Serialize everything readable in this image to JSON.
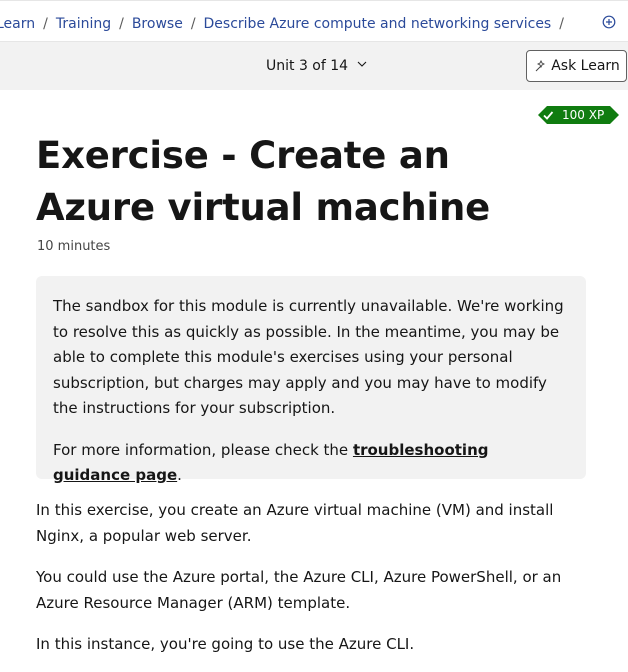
{
  "breadcrumb": {
    "items": [
      "Learn",
      "Training",
      "Browse",
      "Describe Azure compute and networking services"
    ],
    "trailing_sep": "/"
  },
  "unit_nav": {
    "label": "Unit 3 of 14"
  },
  "ask_learn": {
    "label": "Ask Learn"
  },
  "badge": {
    "xp": "100 XP",
    "color": "#107c10"
  },
  "header": {
    "title_line1": "Exercise - Create an",
    "title_line2": "Azure virtual machine",
    "duration": "10 minutes"
  },
  "alert": {
    "text": "The sandbox for this module is currently unavailable. We're working to resolve this as quickly as possible. In the meantime, you may be able to complete this module's exercises using your personal subscription, but charges may apply and you may have to modify the instructions for your subscription.",
    "info_prefix": "For more information, please check the ",
    "info_link": "troubleshooting guidance page",
    "info_suffix": "."
  },
  "content": {
    "paragraphs": [
      "In this exercise, you create an Azure virtual machine (VM) and install Nginx, a popular web server.",
      "You could use the Azure portal, the Azure CLI, Azure PowerShell, or an Azure Resource Manager (ARM) template.",
      "In this instance, you're going to use the Azure CLI."
    ]
  }
}
